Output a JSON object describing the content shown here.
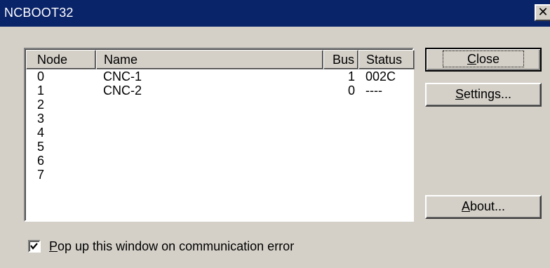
{
  "window": {
    "title": "NCBOOT32",
    "close_glyph": "✕"
  },
  "list": {
    "columns": [
      "Node",
      "Name",
      "Bus",
      "Status"
    ],
    "rows": [
      {
        "node": "0",
        "name": "CNC-1",
        "bus": "1",
        "status": "002C"
      },
      {
        "node": "1",
        "name": "CNC-2",
        "bus": "0",
        "status": "----"
      },
      {
        "node": "2",
        "name": "",
        "bus": "",
        "status": ""
      },
      {
        "node": "3",
        "name": "",
        "bus": "",
        "status": ""
      },
      {
        "node": "4",
        "name": "",
        "bus": "",
        "status": ""
      },
      {
        "node": "5",
        "name": "",
        "bus": "",
        "status": ""
      },
      {
        "node": "6",
        "name": "",
        "bus": "",
        "status": ""
      },
      {
        "node": "7",
        "name": "",
        "bus": "",
        "status": ""
      }
    ]
  },
  "buttons": {
    "close": {
      "mnemonic": "C",
      "rest": "lose"
    },
    "settings": {
      "mnemonic": "S",
      "rest": "ettings..."
    },
    "about": {
      "mnemonic": "A",
      "rest": "bout..."
    }
  },
  "checkbox": {
    "checked": true,
    "mnemonic": "P",
    "rest": "op up this window on communication error"
  },
  "colors": {
    "titlebar": "#0a246a",
    "face": "#d4d0c8"
  }
}
